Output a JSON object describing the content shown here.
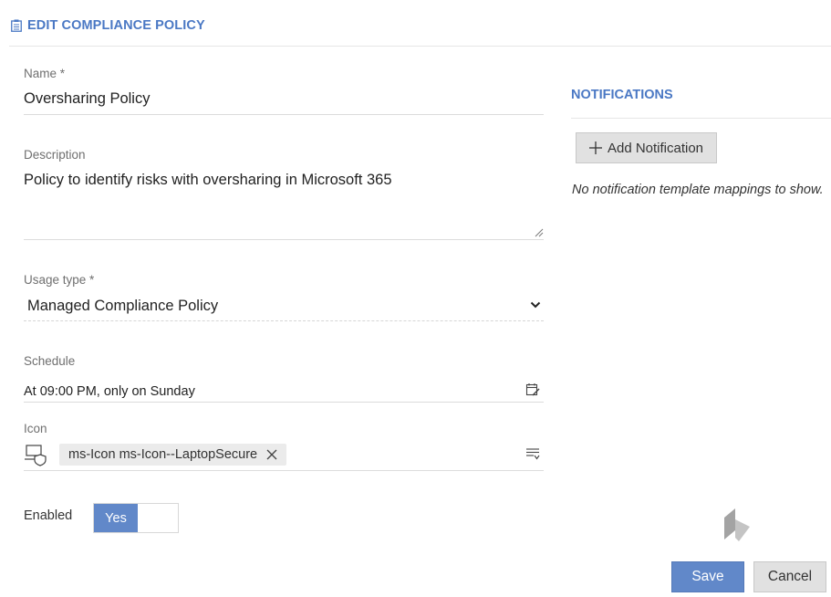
{
  "header": {
    "title": "EDIT COMPLIANCE POLICY",
    "icon": "clipboard-icon",
    "accent_color": "#4a78c4"
  },
  "form": {
    "name": {
      "label": "Name *",
      "value": "Oversharing Policy"
    },
    "description": {
      "label": "Description",
      "value": "Policy to identify risks with oversharing in Microsoft 365"
    },
    "usage_type": {
      "label": "Usage type *",
      "value": "Managed Compliance Policy"
    },
    "schedule": {
      "label": "Schedule",
      "value": "At 09:00 PM, only on Sunday",
      "icon": "calendar-edit-icon"
    },
    "icon_field": {
      "label": "Icon",
      "chip": "ms-Icon ms-Icon--LaptopSecure",
      "preview_icon": "laptop-secure-icon",
      "picker_icon": "filter-list-icon"
    },
    "enabled": {
      "label": "Enabled",
      "toggle_on_label": "Yes",
      "value": true,
      "on_color": "#6188c9"
    }
  },
  "notifications": {
    "title": "NOTIFICATIONS",
    "add_button": "Add Notification",
    "empty_text": "No notification template mappings to show."
  },
  "actions": {
    "save": "Save",
    "cancel": "Cancel",
    "save_color": "#6188c9"
  }
}
